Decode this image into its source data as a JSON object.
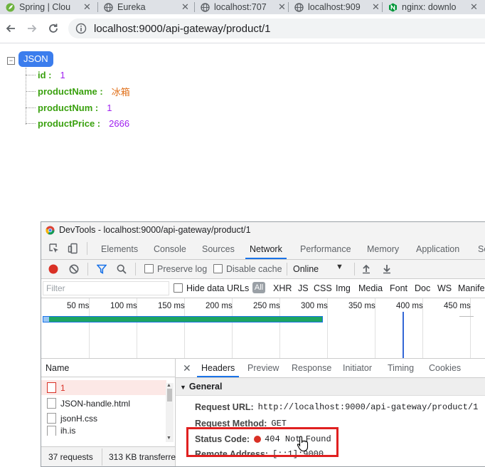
{
  "browser": {
    "tabs": [
      {
        "label": "Spring | Clou",
        "icon": "spring-leaf-icon",
        "icon_color": "#6db33f"
      },
      {
        "label": "Eureka",
        "icon": "globe-icon",
        "icon_color": "#5f6368"
      },
      {
        "label": "localhost:707",
        "icon": "globe-icon",
        "icon_color": "#5f6368"
      },
      {
        "label": "localhost:909",
        "icon": "globe-icon",
        "icon_color": "#5f6368"
      },
      {
        "label": "nginx: downlo",
        "icon": "nginx-icon",
        "icon_color": "#009639"
      }
    ],
    "url": "localhost:9000/api-gateway/product/1"
  },
  "json_viewer": {
    "badge": "JSON",
    "collapse_symbol": "−",
    "fields": [
      {
        "key": "id :",
        "value": "1",
        "type": "number"
      },
      {
        "key": "productName :",
        "value": "冰箱",
        "type": "string"
      },
      {
        "key": "productNum :",
        "value": "1",
        "type": "number"
      },
      {
        "key": "productPrice :",
        "value": "2666",
        "type": "number"
      }
    ]
  },
  "devtools": {
    "title": "DevTools - localhost:9000/api-gateway/product/1",
    "main_tabs": [
      "Elements",
      "Console",
      "Sources",
      "Network",
      "Performance",
      "Memory",
      "Application",
      "Se"
    ],
    "active_tab": "Network",
    "controls": {
      "preserve_log": "Preserve log",
      "disable_cache": "Disable cache",
      "throttle": "Online"
    },
    "filter": {
      "placeholder": "Filter",
      "hide_data_urls": "Hide data URLs",
      "types": [
        "All",
        "XHR",
        "JS",
        "CSS",
        "Img",
        "Media",
        "Font",
        "Doc",
        "WS",
        "Manife"
      ]
    },
    "timeline_ticks": [
      "50 ms",
      "100 ms",
      "150 ms",
      "200 ms",
      "250 ms",
      "300 ms",
      "350 ms",
      "400 ms",
      "450 ms"
    ],
    "requests_header": "Name",
    "requests": [
      "1",
      "JSON-handle.html",
      "jsonH.css",
      "ih.is"
    ],
    "status_bar": {
      "requests": "37 requests",
      "transferred": "313 KB transferre"
    },
    "detail_tabs": [
      "Headers",
      "Preview",
      "Response",
      "Initiator",
      "Timing",
      "Cookies"
    ],
    "active_detail_tab": "Headers",
    "general_label": "General",
    "headers": {
      "request_url_key": "Request URL:",
      "request_url_val": "http://localhost:9000/api-gateway/product/1",
      "method_key": "Request Method:",
      "method_val": "GET",
      "status_key": "Status Code:",
      "status_val": "404 Not Found",
      "remote_key": "Remote Address:",
      "remote_val": "[::1]:9000"
    },
    "colors": {
      "accent": "#1a73e8",
      "error": "#d93025",
      "highlight_box": "#e02020"
    }
  }
}
